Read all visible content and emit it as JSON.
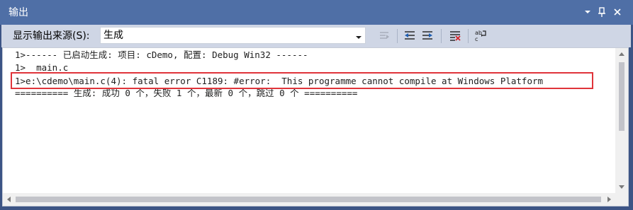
{
  "window": {
    "title": "输出",
    "dropdown_icon": "chevron-down-icon",
    "pin_icon": "pin-icon",
    "close_icon": "close-icon"
  },
  "toolbar": {
    "source_label": "显示输出来源(S):",
    "source_value": "生成",
    "tools": [
      {
        "name": "find-message-icon",
        "enabled": false
      },
      {
        "name": "go-to-previous-message-icon",
        "enabled": true
      },
      {
        "name": "go-to-next-message-icon",
        "enabled": true
      },
      {
        "name": "clear-all-icon",
        "enabled": true
      },
      {
        "name": "toggle-word-wrap-icon",
        "enabled": true
      }
    ]
  },
  "output": {
    "lines": [
      "1>------ 已启动生成: 项目: cDemo, 配置: Debug Win32 ------",
      "1>  main.c",
      "1>e:\\cdemo\\main.c(4): fatal error C1189: #error:  This programme cannot compile at Windows Platform",
      "========== 生成: 成功 0 个，失败 1 个，最新 0 个，跳过 0 个 =========="
    ],
    "highlight_color": "#e0343a"
  },
  "colors": {
    "titlebar": "#4f6fa6",
    "toolbar": "#cfd6e5",
    "frame": "#3c5485"
  }
}
